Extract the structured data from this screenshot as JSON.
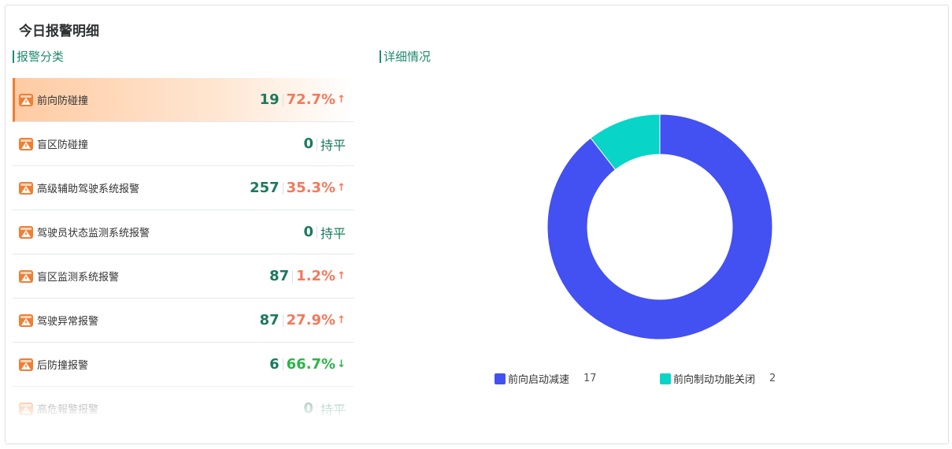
{
  "page": {
    "title": "今日报警明细"
  },
  "sections": {
    "category": "报警分类",
    "detail": "详细情况"
  },
  "alarms": [
    {
      "label": "前向防碰撞",
      "count": "19",
      "pct": "72.7%",
      "trend": "up",
      "active": true
    },
    {
      "label": "盲区防碰撞",
      "count": "0",
      "pct": "持平",
      "trend": "flat",
      "active": false
    },
    {
      "label": "高级辅助驾驶系统报警",
      "count": "257",
      "pct": "35.3%",
      "trend": "up",
      "active": false
    },
    {
      "label": "驾驶员状态监测系统报警",
      "count": "0",
      "pct": "持平",
      "trend": "flat",
      "active": false
    },
    {
      "label": "盲区监测系统报警",
      "count": "87",
      "pct": "1.2%",
      "trend": "up",
      "active": false
    },
    {
      "label": "驾驶异常报警",
      "count": "87",
      "pct": "27.9%",
      "trend": "up",
      "active": false
    },
    {
      "label": "后防撞报警",
      "count": "6",
      "pct": "66.7%",
      "trend": "down",
      "active": false
    },
    {
      "label": "高危報警报警",
      "count": "0",
      "pct": "持平",
      "trend": "flat",
      "active": false
    }
  ],
  "icons": {
    "alarm": "warning-light-icon",
    "up": "arrow-up-icon",
    "down": "arrow-down-icon"
  },
  "colors": {
    "accent": "#1a7a5e",
    "up": "#f4795b",
    "down": "#2cb34a",
    "icon": "#f07e33"
  },
  "chart_data": {
    "type": "pie",
    "donut": true,
    "slices": [
      {
        "name": "前向启动减速",
        "value": 17,
        "color": "#4350f2"
      },
      {
        "name": "前向制动功能关闭",
        "value": 2,
        "color": "#09d4c8"
      }
    ]
  }
}
